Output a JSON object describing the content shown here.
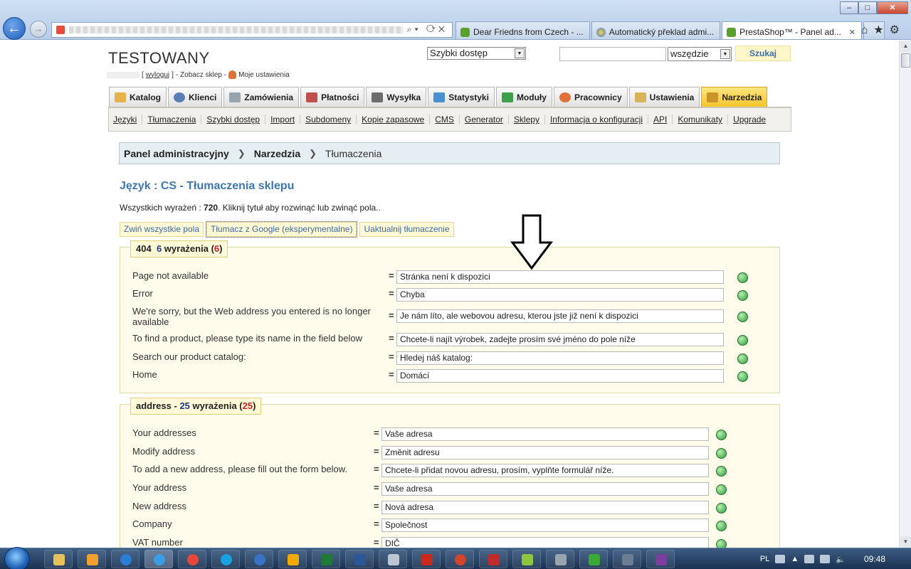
{
  "browser": {
    "tabs": [
      {
        "label": "Dear Friedns from Czech - ..."
      },
      {
        "label": "Automatický překlad admi..."
      },
      {
        "label": "PrestaShop™ - Panel ad..."
      }
    ],
    "window_controls": {
      "minimize": "–",
      "maximize": "□",
      "close": "✕"
    }
  },
  "header": {
    "site_title": "TESTOWANY",
    "logout": "wyloguj",
    "view_shop": "- Zobacz sklep -",
    "my_settings": "Moje ustawienia",
    "quick_access": "Szybki dostęp",
    "search_value": "",
    "search_scope": "wszędzie",
    "search_button": "Szukaj"
  },
  "main_nav": [
    {
      "label": "Katalog",
      "color": "#e6b24a"
    },
    {
      "label": "Klienci",
      "color": "#5a7fb5"
    },
    {
      "label": "Zamówienia",
      "color": "#9aa4ad"
    },
    {
      "label": "Płatności",
      "color": "#c0504d"
    },
    {
      "label": "Wysyłka",
      "color": "#6d6d6d"
    },
    {
      "label": "Statystyki",
      "color": "#4a8fd0"
    },
    {
      "label": "Moduły",
      "color": "#3da04a"
    },
    {
      "label": "Pracownicy",
      "color": "#e0703a"
    },
    {
      "label": "Ustawienia",
      "color": "#d9b35a"
    },
    {
      "label": "Narzedzia",
      "color": "#c9952a"
    }
  ],
  "sub_nav": [
    "Języki",
    "Tłumaczenia",
    "Szybki dostęp",
    "Import",
    "Subdomeny",
    "Kopie zapasowe",
    "CMS",
    "Generator",
    "Sklepy",
    "Informacja o konfiguracji",
    "API",
    "Komunikaty",
    "Upgrade"
  ],
  "breadcrumb": {
    "item1": "Panel administracyjny",
    "item2": "Narzedzia",
    "item3": "Tłumaczenia"
  },
  "content": {
    "language_title": "Język : CS - Tłumaczenia sklepu",
    "count_prefix": "Wszystkich wyrażeń :",
    "count_value": "720",
    "count_suffix": ". Kliknij tytuł aby rozwinąć lub zwinąć pola..",
    "btn_collapse": "Zwiń wszystkie pola",
    "btn_google": "Tłumacz z Google (eksperymentalne)",
    "btn_update": "Uaktualnij tłumaczenie"
  },
  "sections": [
    {
      "name": "404",
      "count": "6",
      "word": "wyrażenia",
      "missing": "6",
      "rows": [
        {
          "label": "Page not available",
          "value": "Stránka není k dispozici"
        },
        {
          "label": "Error",
          "value": "Chyba"
        },
        {
          "label": "We're sorry, but the Web address you entered is no longer available",
          "value": "Je nám líto, ale webovou adresu, kterou jste již není k dispozici"
        },
        {
          "label": "To find a product, please type its name in the field below",
          "value": "Chcete-li najít výrobek, zadejte prosím své jméno do pole níže"
        },
        {
          "label": "Search our product catalog:",
          "value": "Hledej náš katalog:"
        },
        {
          "label": "Home",
          "value": "Domácí"
        }
      ]
    },
    {
      "name": "address",
      "count": "25",
      "word": "wyrażenia",
      "missing": "25",
      "rows": [
        {
          "label": "Your addresses",
          "value": "Vaše adresa"
        },
        {
          "label": "Modify address",
          "value": "Změnit adresu"
        },
        {
          "label": "To add a new address, please fill out the form below.",
          "value": "Chcete-li přidat novou adresu, prosím, vyplňte formulář níže."
        },
        {
          "label": "Your address",
          "value": "Vaše adresa"
        },
        {
          "label": "New address",
          "value": "Nová adresa"
        },
        {
          "label": "Company",
          "value": "Společnost"
        },
        {
          "label": "VAT number",
          "value": "DIČ"
        }
      ]
    }
  ],
  "taskbar": {
    "lang": "PL",
    "time": "09:48"
  },
  "colors": {
    "accent_blue": "#3d78b5",
    "active_tab": "#f6c52a",
    "missing_red": "#d02020"
  }
}
